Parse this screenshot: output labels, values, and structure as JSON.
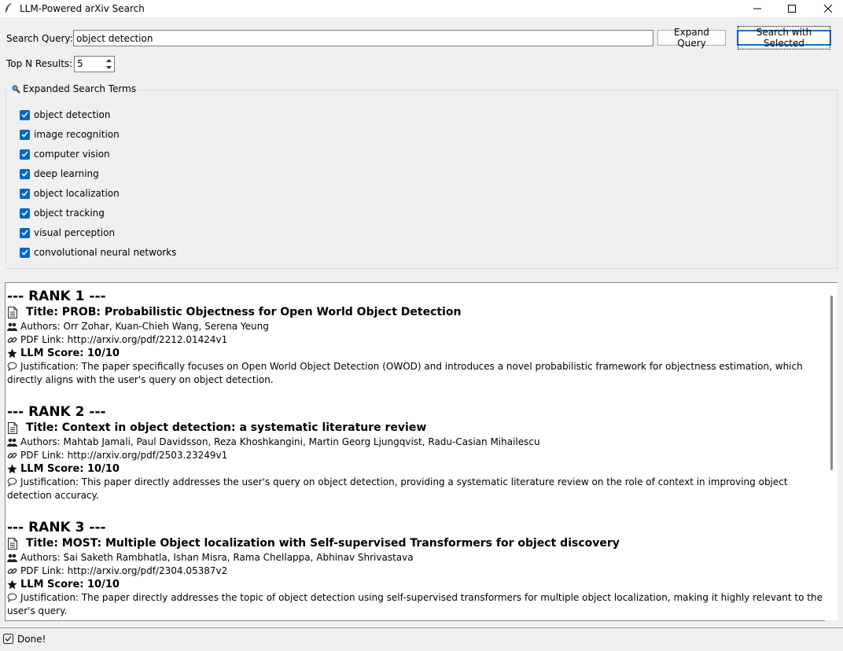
{
  "window": {
    "title": "LLM-Powered arXiv Search",
    "icon": "feather-icon"
  },
  "search": {
    "label": "Search Query:",
    "value": "object detection",
    "expand_button": "Expand Query",
    "search_selected_button": "Search with Selected"
  },
  "top_n": {
    "label": "Top N Results:",
    "value": "5"
  },
  "expanded_terms": {
    "legend": "Expanded Search Terms",
    "legend_icon": "magnifier-icon",
    "items": [
      {
        "label": "object detection",
        "checked": true
      },
      {
        "label": "image recognition",
        "checked": true
      },
      {
        "label": "computer vision",
        "checked": true
      },
      {
        "label": "deep learning",
        "checked": true
      },
      {
        "label": "object localization",
        "checked": true
      },
      {
        "label": "object tracking",
        "checked": true
      },
      {
        "label": "visual perception",
        "checked": true
      },
      {
        "label": "convolutional neural networks",
        "checked": true
      }
    ]
  },
  "results": [
    {
      "rank": "--- RANK 1 ---",
      "title": "Title: PROB: Probabilistic Objectness for Open World Object Detection",
      "authors": "Authors: Orr Zohar, Kuan-Chieh Wang, Serena Yeung",
      "pdf": "PDF Link: http://arxiv.org/pdf/2212.01424v1",
      "score": "LLM Score: 10/10",
      "justification": "Justification: The paper specifically focuses on Open World Object Detection (OWOD) and introduces a novel probabilistic framework for objectness estimation, which directly aligns with the user's query on object detection."
    },
    {
      "rank": "--- RANK 2 ---",
      "title": "Title: Context in object detection: a systematic literature review",
      "authors": "Authors: Mahtab Jamali, Paul Davidsson, Reza Khoshkangini, Martin Georg Ljungqvist, Radu-Casian Mihailescu",
      "pdf": "PDF Link: http://arxiv.org/pdf/2503.23249v1",
      "score": "LLM Score: 10/10",
      "justification": "Justification: This paper directly addresses the user's query on object detection, providing a systematic literature review on the role of context in improving object detection accuracy."
    },
    {
      "rank": "--- RANK 3 ---",
      "title": "Title: MOST: Multiple Object localization with Self-supervised Transformers for object discovery",
      "authors": "Authors: Sai Saketh Rambhatla, Ishan Misra, Rama Chellappa, Abhinav Shrivastava",
      "pdf": "PDF Link: http://arxiv.org/pdf/2304.05387v2",
      "score": "LLM Score: 10/10",
      "justification": "Justification: The paper directly addresses the topic of object detection using self-supervised transformers for multiple object localization, making it highly relevant to the user's query."
    }
  ],
  "status": {
    "text": "Done!",
    "icon": "check-box-icon"
  }
}
